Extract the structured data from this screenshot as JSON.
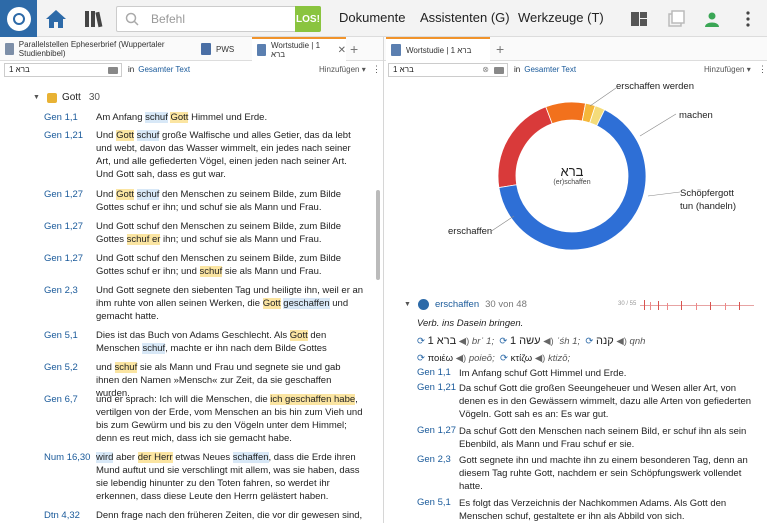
{
  "toolbar": {
    "search_placeholder": "Befehl",
    "go_label": "LOS!",
    "menu_documents": "Dokumente",
    "menu_assistants": "Assistenten (G)",
    "menu_tools": "Werkzeuge (T)"
  },
  "left": {
    "tabs": [
      {
        "label": "Parallelstellen Epheserbrief (Wuppertaler Studienbibel)"
      },
      {
        "label": "PWS"
      },
      {
        "label": "Wortstudie | 1 ברא"
      }
    ],
    "search_value": "1 ברא",
    "in_label": "in",
    "scope": "Gesamter Text",
    "add_label": "Hinzufügen ▾",
    "group": {
      "label": "Gott",
      "count": "30"
    },
    "rows": [
      {
        "ref": "Gen 1,1",
        "parts": [
          [
            "Am Anfang ",
            ""
          ],
          [
            "schuf",
            "b"
          ],
          [
            " ",
            ""
          ],
          [
            "Gott",
            "y"
          ],
          [
            " Himmel und Erde.",
            ""
          ]
        ]
      },
      {
        "ref": "Gen 1,21",
        "parts": [
          [
            "Und ",
            ""
          ],
          [
            "Gott",
            "y"
          ],
          [
            " ",
            ""
          ],
          [
            "schuf",
            "b"
          ],
          [
            " große Walfische und alles Getier, das da lebt und webt, davon das Wasser wimmelt, ein jedes nach seiner Art, und alle gefiederten Vögel, einen jeden nach seiner Art. Und Gott sah, dass es gut war.",
            ""
          ]
        ]
      },
      {
        "ref": "Gen 1,27",
        "parts": [
          [
            "Und ",
            ""
          ],
          [
            "Gott",
            "y"
          ],
          [
            " ",
            ""
          ],
          [
            "schuf",
            "b"
          ],
          [
            " den Menschen zu seinem Bilde, zum Bilde Gottes schuf er ihn; und schuf sie als Mann und Frau.",
            ""
          ]
        ]
      },
      {
        "ref": "Gen 1,27",
        "parts": [
          [
            "Und Gott schuf den Menschen zu seinem Bilde, zum Bilde Gottes ",
            ""
          ],
          [
            "schuf er",
            "y"
          ],
          [
            " ihn; und schuf sie als Mann und Frau.",
            ""
          ]
        ]
      },
      {
        "ref": "Gen 1,27",
        "parts": [
          [
            "Und Gott schuf den Menschen zu seinem Bilde, zum Bilde Gottes schuf er ihn; und ",
            ""
          ],
          [
            "schuf",
            "y"
          ],
          [
            " sie als Mann und Frau.",
            ""
          ]
        ]
      },
      {
        "ref": "Gen 2,3",
        "parts": [
          [
            "Und Gott segnete den siebenten Tag und heiligte ihn, weil er an ihm ruhte von allen seinen Werken, die ",
            ""
          ],
          [
            "Gott",
            "y"
          ],
          [
            " ",
            ""
          ],
          [
            "geschaffen",
            "b"
          ],
          [
            " und gemacht hatte.",
            ""
          ]
        ]
      },
      {
        "ref": "Gen 5,1",
        "parts": [
          [
            "Dies ist das Buch von Adams Geschlecht. Als ",
            ""
          ],
          [
            "Gott",
            "y"
          ],
          [
            " den Menschen ",
            ""
          ],
          [
            "schuf",
            "b"
          ],
          [
            ", machte er ihn nach dem Bilde Gottes",
            ""
          ]
        ]
      },
      {
        "ref": "Gen 5,2",
        "parts": [
          [
            "und ",
            ""
          ],
          [
            "schuf",
            "y"
          ],
          [
            " sie als Mann und Frau und segnete sie und gab ihnen den Namen »Mensch« zur Zeit, da sie geschaffen wurden.",
            ""
          ]
        ]
      },
      {
        "ref": "Gen 6,7",
        "parts": [
          [
            "und er sprach: Ich will die Menschen, die ",
            ""
          ],
          [
            "ich geschaffen habe",
            "y"
          ],
          [
            ", vertilgen von der Erde, vom Menschen an bis hin zum Vieh und bis zum Gewürm und bis zu den Vögeln unter dem Himmel; denn es reut mich, dass ich sie gemacht habe.",
            ""
          ]
        ]
      },
      {
        "ref": "Num 16,30",
        "parts": [
          [
            "wird",
            "b"
          ],
          [
            " aber ",
            ""
          ],
          [
            "der Herr",
            "y"
          ],
          [
            " etwas Neues ",
            ""
          ],
          [
            "schaffen",
            "b"
          ],
          [
            ", dass die Erde ihren Mund auftut und sie verschlingt mit allem, was sie haben, dass sie lebendig hinunter zu den Toten fahren, so werdet ihr erkennen, dass diese Leute den Herrn gelästert haben.",
            ""
          ]
        ]
      },
      {
        "ref": "Dtn 4,32",
        "parts": [
          [
            "Denn frage nach den früheren Zeiten, die vor dir gewesen sind,",
            ""
          ]
        ]
      }
    ]
  },
  "right": {
    "tab": "Wortstudie | 1 ברא",
    "search_value": "1 ברא",
    "in_label": "in",
    "scope": "Gesamter Text",
    "add_label": "Hinzufügen ▾",
    "donut": {
      "center_word": "ברא",
      "center_sub": "(er)schaffen",
      "labels": [
        "erschaffen werden",
        "machen",
        "Schöpfergott tun (handeln)",
        "erschaffen"
      ]
    },
    "chart_data": {
      "type": "pie",
      "categories": [
        "erschaffen",
        "erschaffen werden",
        "machen",
        "Schöpfergott tun (handeln)",
        "other"
      ],
      "values": [
        30,
        10,
        4,
        1,
        1
      ],
      "colors": [
        "#2e6fd6",
        "#d93a3a",
        "#f2711c",
        "#f5b73a",
        "#f4dc7a"
      ]
    },
    "sense": {
      "title": "erschaffen",
      "count": "30 von 48",
      "counter": "30 / 55",
      "definition": "Verb. ins Dasein bringen."
    },
    "lemmas": [
      {
        "word": "ברא 1",
        "tr": "brʾ 1;"
      },
      {
        "word": "עשה 1",
        "tr": "ʿśh 1;"
      },
      {
        "word": "קנה",
        "tr": "qnh"
      },
      {
        "word": "ποιέω",
        "tr": "poieō;"
      },
      {
        "word": "κτίζω",
        "tr": "ktizō;"
      }
    ],
    "rows": [
      {
        "ref": "Gen 1,1",
        "text": "Im Anfang schuf Gott Himmel und Erde."
      },
      {
        "ref": "Gen 1,21",
        "text": "Da schuf Gott die großen Seeungeheuer und Wesen aller Art, von denen es in den Gewässern wimmelt, dazu alle Arten von gefiederten Vögeln. Gott sah es an: Es war gut."
      },
      {
        "ref": "Gen 1,27",
        "text": "Da schuf Gott den Menschen nach seinem Bild, er schuf ihn als sein Ebenbild, als Mann und Frau schuf er sie."
      },
      {
        "ref": "Gen 2,3",
        "text": "Gott segnete ihn und machte ihn zu einem besonderen Tag, denn an diesem Tag ruhte Gott, nachdem er sein Schöpfungswerk vollendet hatte."
      },
      {
        "ref": "Gen 5,1",
        "text": "Es folgt das Verzeichnis der Nachkommen Adams. Als Gott den Menschen schuf, gestaltete er ihn als Abbild von sich."
      }
    ]
  }
}
